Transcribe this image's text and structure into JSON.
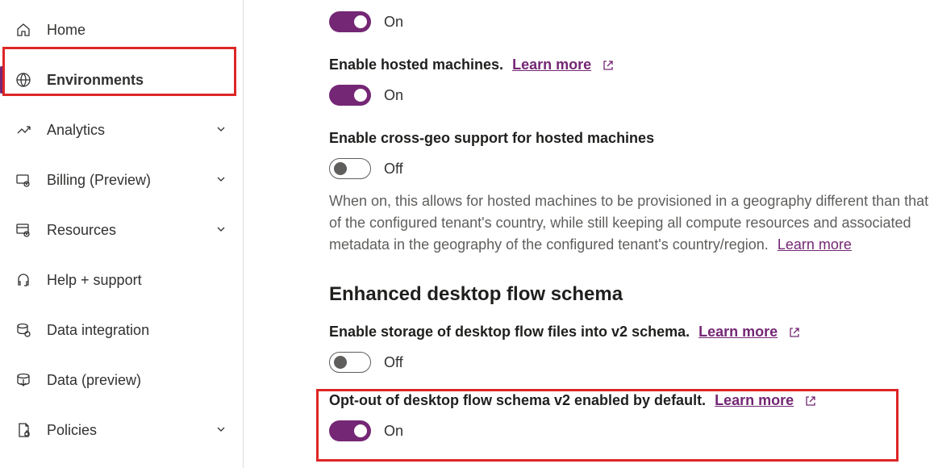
{
  "sidebar": {
    "items": [
      {
        "label": "Home"
      },
      {
        "label": "Environments"
      },
      {
        "label": "Analytics"
      },
      {
        "label": "Billing (Preview)"
      },
      {
        "label": "Resources"
      },
      {
        "label": "Help + support"
      },
      {
        "label": "Data integration"
      },
      {
        "label": "Data (preview)"
      },
      {
        "label": "Policies"
      }
    ]
  },
  "content": {
    "top_toggle": {
      "state": "On"
    },
    "hosted_machines": {
      "title": "Enable hosted machines.",
      "learn": "Learn more",
      "state": "On"
    },
    "cross_geo": {
      "title": "Enable cross-geo support for hosted machines",
      "state": "Off",
      "description_a": "When on, this allows for hosted machines to be provisioned in a geography different than that of the configured tenant's country, while still keeping all compute resources and associated metadata in the geography of the configured tenant's country/region.",
      "learn": "Learn more"
    },
    "section_header": "Enhanced desktop flow schema",
    "v2_schema": {
      "title": "Enable storage of desktop flow files into v2 schema.",
      "learn": "Learn more",
      "state": "Off"
    },
    "opt_out": {
      "title": "Opt-out of desktop flow schema v2 enabled by default.",
      "learn": "Learn more",
      "state": "On"
    }
  }
}
